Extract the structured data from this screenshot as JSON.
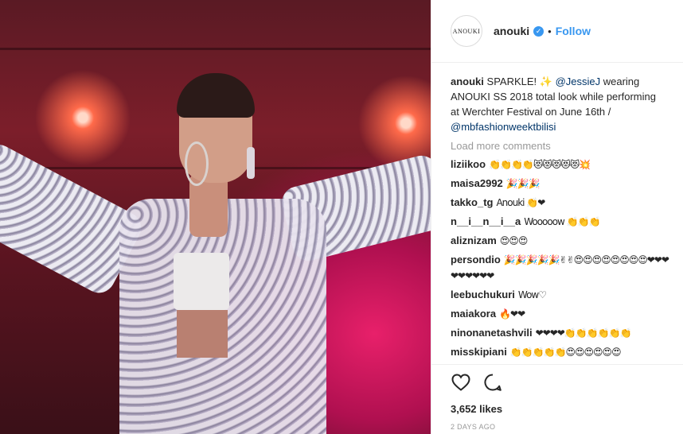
{
  "post": {
    "username": "anouki",
    "avatar_text": "ANOUKI",
    "verified": true,
    "dot": "•",
    "follow_label": "Follow"
  },
  "caption": {
    "user": "anouki",
    "text_before": "SPARKLE! ✨ ",
    "mention1": "@JessieJ",
    "text_middle": " wearing ANOUKI SS 2018 total look while performing at Werchter Festival on June 16th / ",
    "mention2": "@mbfashionweektbilisi"
  },
  "load_more_label": "Load more comments",
  "comments": [
    {
      "user": "liziikoo",
      "text": "👏👏👏👏😻😻😻😻😻💥"
    },
    {
      "user": "maisa2992",
      "text": "🎉🎉🎉"
    },
    {
      "user": "takko_tg",
      "text": "Anouki 👏❤"
    },
    {
      "user": "n__i__n__i__a",
      "text": "Wooooow 👏👏👏"
    },
    {
      "user": "aliznizam",
      "text": "😍😍😍"
    },
    {
      "user": "persondio",
      "text": "🎉🎉🎉🎉🎉✌✌😍😍😍😍😍😍😍😍❤❤❤❤❤❤❤❤❤"
    },
    {
      "user": "leebuchukuri",
      "text": "Wow♡"
    },
    {
      "user": "maiakora",
      "text": "🔥❤❤"
    },
    {
      "user": "ninonanetashvili",
      "text": "❤❤❤❤👏👏👏👏👏👏"
    },
    {
      "user": "misskipiani",
      "text": "👏👏👏👏👏😍😍😍😍😍😍"
    }
  ],
  "likes_label": "3,652 likes",
  "time_ago": "2 DAYS AGO",
  "icons": {
    "like": "heart-outline-icon",
    "comment": "speech-bubble-icon",
    "verified": "verified-badge-icon"
  },
  "colors": {
    "link_blue": "#3897f0",
    "mention_blue": "#003569",
    "muted": "#999999"
  }
}
